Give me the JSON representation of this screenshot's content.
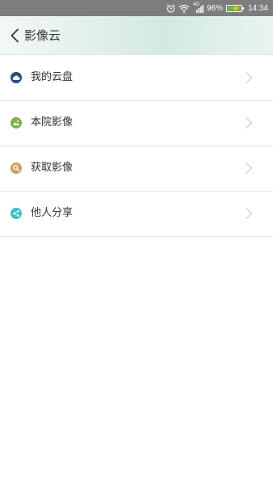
{
  "status_bar": {
    "network": "4G",
    "battery": "96%",
    "time": "14:34",
    "icons": [
      "alarm-icon",
      "wifi-icon",
      "signal-icon",
      "battery-icon"
    ]
  },
  "header": {
    "title": "影像云",
    "back_icon": "chevron-left-icon"
  },
  "menu": {
    "items": [
      {
        "label": "我的云盘",
        "icon": "cloud-icon",
        "color": "#2b4d7a"
      },
      {
        "label": "本院影像",
        "icon": "image-icon",
        "color": "#7fb24e"
      },
      {
        "label": "获取影像",
        "icon": "search-icon",
        "color": "#c9a45c"
      },
      {
        "label": "他人分享",
        "icon": "share-icon",
        "color": "#3fc1c0"
      }
    ],
    "chevron_icon": "chevron-right-icon"
  },
  "colors": {
    "status_bar_bg": "#7d7d7d",
    "battery_green": "#67c23a",
    "divider": "#e6e6e6",
    "text": "#333333",
    "chevron": "#c8c8c8"
  }
}
